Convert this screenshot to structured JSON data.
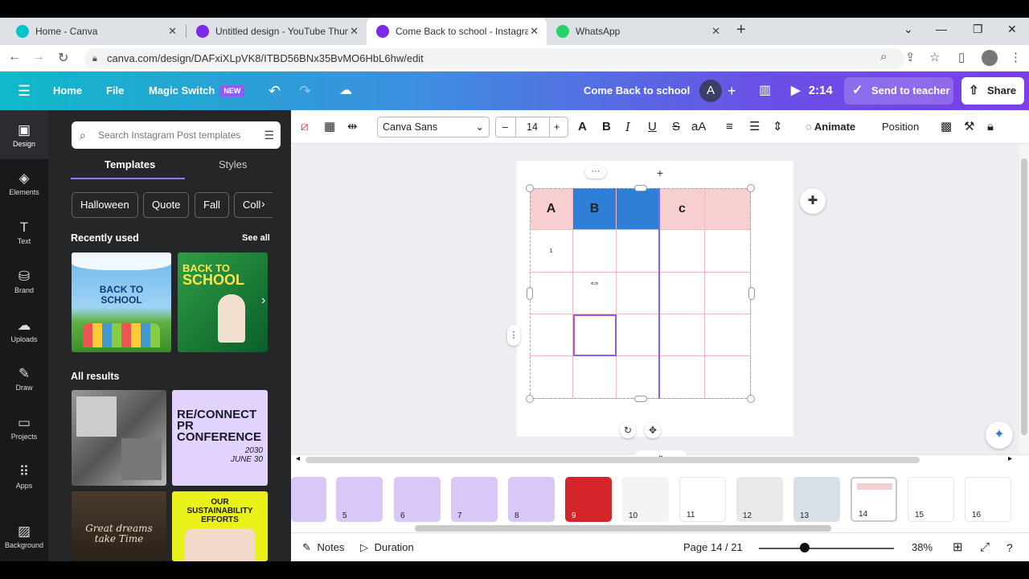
{
  "browser": {
    "tabs": [
      {
        "title": "Home - Canva",
        "favicon_color": "#00c4cc"
      },
      {
        "title": "Untitled design - YouTube Thum",
        "favicon_color": "#7d2ae8"
      },
      {
        "title": "Come Back to school - Instagra",
        "favicon_color": "#7d2ae8"
      },
      {
        "title": "WhatsApp",
        "favicon_color": "#25d366"
      }
    ],
    "url": "canva.com/design/DAFxiXLpVK8/ITBD56BNx35BvMO6HbL6hw/edit"
  },
  "header": {
    "home": "Home",
    "file": "File",
    "magic_switch": "Magic Switch",
    "new_badge": "NEW",
    "design_title": "Come Back to school",
    "avatar_letter": "A",
    "duration": "2:14",
    "send_to_teacher": "Send to teacher",
    "share": "Share"
  },
  "rail": [
    {
      "label": "Design",
      "icon": "▣"
    },
    {
      "label": "Elements",
      "icon": "◈"
    },
    {
      "label": "Text",
      "icon": "T"
    },
    {
      "label": "Brand",
      "icon": "⛁"
    },
    {
      "label": "Uploads",
      "icon": "☁"
    },
    {
      "label": "Draw",
      "icon": "✎"
    },
    {
      "label": "Projects",
      "icon": "▭"
    },
    {
      "label": "Apps",
      "icon": "⠿"
    },
    {
      "label": "Background",
      "icon": "▨"
    }
  ],
  "panel": {
    "search_placeholder": "Search Instagram Post templates",
    "tab_templates": "Templates",
    "tab_styles": "Styles",
    "chips": [
      "Halloween",
      "Quote",
      "Fall",
      "Coll"
    ],
    "recently_used": "Recently used",
    "see_all": "See all",
    "all_results": "All results",
    "thumb1": {
      "line1": "BACK TO",
      "line2": "SCHOOL"
    },
    "thumb2": {
      "line1": "BACK TO",
      "line2": "SCHOOL"
    },
    "thumb3": {
      "line1": "RE/CONNECT",
      "line2": "PR",
      "line3": "CONFERENCE",
      "date": "2030 JUNE 30"
    },
    "thumb4": {
      "line1": "OUR",
      "line2": "SUSTAINABILITY",
      "line3": "EFFORTS"
    },
    "thumb5": {
      "line1": "Great dreams",
      "line2": "take Time"
    }
  },
  "toolbar": {
    "font": "Canva Sans",
    "font_size": "14",
    "minus": "–",
    "plus": "+",
    "animate": "Animate",
    "position": "Position"
  },
  "table": {
    "headers": [
      "A",
      "B",
      "",
      "c",
      ""
    ],
    "cell_text": "1"
  },
  "pages": [
    {
      "num": "",
      "bg": "#d9c8f7"
    },
    {
      "num": "5",
      "bg": "#d9c8f7"
    },
    {
      "num": "6",
      "bg": "#d9c8f7"
    },
    {
      "num": "7",
      "bg": "#d9c8f7"
    },
    {
      "num": "8",
      "bg": "#d9c8f7"
    },
    {
      "num": "9",
      "bg": "#d4252b"
    },
    {
      "num": "10",
      "bg": "#f3f3f3"
    },
    {
      "num": "11",
      "bg": "#ffffff"
    },
    {
      "num": "12",
      "bg": "#e9e9e9"
    },
    {
      "num": "13",
      "bg": "#d8dfe6"
    },
    {
      "num": "14",
      "bg": "#ffffff"
    },
    {
      "num": "15",
      "bg": "#ffffff"
    },
    {
      "num": "16",
      "bg": "#ffffff"
    }
  ],
  "footer": {
    "notes": "Notes",
    "duration": "Duration",
    "page_indicator": "Page 14 / 21",
    "zoom": "38%"
  },
  "colors": {
    "header_gradient_start": "#0fb9c9",
    "header_gradient_end": "#7b3ee8",
    "table_header_pink": "#f8cfd1",
    "table_header_blue": "#2f7fd8",
    "selection_purple": "#8b5cf6"
  }
}
